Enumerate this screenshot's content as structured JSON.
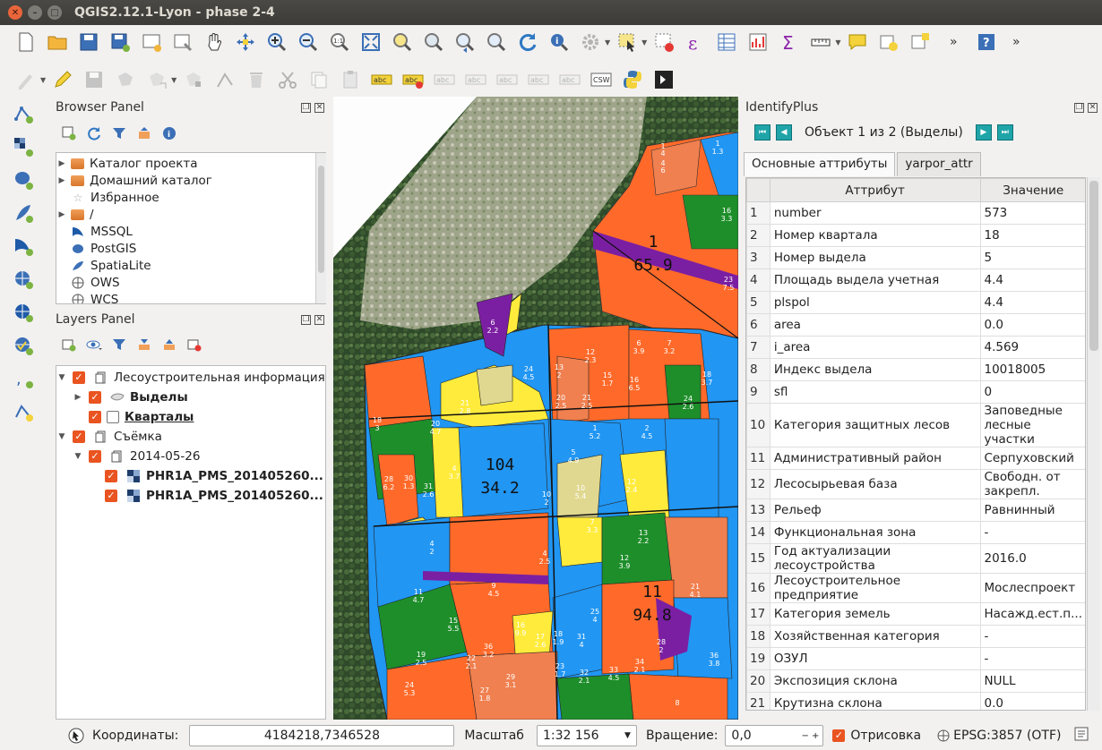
{
  "window": {
    "title": "QGIS2.12.1-Lyon - phase 2-4"
  },
  "browser_panel": {
    "title": "Browser Panel",
    "items": [
      {
        "label": "Каталог проекта",
        "icon": "folder-icon",
        "expandable": true
      },
      {
        "label": "Домашний каталог",
        "icon": "folder-icon",
        "expandable": true
      },
      {
        "label": "Избранное",
        "icon": "star-icon",
        "expandable": false
      },
      {
        "label": "/",
        "icon": "folder-icon",
        "expandable": true
      },
      {
        "label": "MSSQL",
        "icon": "mssql-icon",
        "expandable": false
      },
      {
        "label": "PostGIS",
        "icon": "postgis-icon",
        "expandable": false
      },
      {
        "label": "SpatiaLite",
        "icon": "spatialite-icon",
        "expandable": false
      },
      {
        "label": "OWS",
        "icon": "globe-icon",
        "expandable": false
      },
      {
        "label": "WCS",
        "icon": "globe-icon",
        "expandable": false
      }
    ]
  },
  "layers_panel": {
    "title": "Layers Panel",
    "group1": "Лесоустроительная информация",
    "layer_vydely": "Выделы",
    "layer_kvartaly": "Кварталы",
    "group2": "Съёмка",
    "subgroup": "2014-05-26",
    "raster1": "PHR1A_PMS_201405260...",
    "raster2": "PHR1A_PMS_201405260..."
  },
  "map": {
    "labels": [
      {
        "text": "1\n65.9"
      },
      {
        "text": "104\n34.2"
      },
      {
        "text": "11\n94.8"
      }
    ]
  },
  "identify_panel": {
    "title": "IdentifyPlus",
    "nav_text": "Объект 1 из 2 (Выделы)",
    "tabs": [
      "Основные аттрибуты",
      "yarpor_attr"
    ],
    "col_attr": "Аттрибут",
    "col_value": "Значение",
    "rows": [
      [
        "1",
        "number",
        "573"
      ],
      [
        "2",
        "Номер квартала",
        "18"
      ],
      [
        "3",
        "Номер выдела",
        "5"
      ],
      [
        "4",
        "Площадь выдела учетная",
        "4.4"
      ],
      [
        "5",
        "plspol",
        "4.4"
      ],
      [
        "6",
        "area",
        "0.0"
      ],
      [
        "7",
        "i_area",
        "4.569"
      ],
      [
        "8",
        "Индекс выдела",
        "10018005"
      ],
      [
        "9",
        "sfl",
        "0"
      ],
      [
        "10",
        "Категория защитных лесов",
        "Заповедные лесные участки"
      ],
      [
        "11",
        "Административный район",
        "Серпуховский"
      ],
      [
        "12",
        "Лесосырьевая база",
        "Свободн. от закрепл."
      ],
      [
        "13",
        "Рельеф",
        "Равнинный"
      ],
      [
        "14",
        "Функциональная зона",
        "-"
      ],
      [
        "15",
        "Год актуализации лесоустройства",
        "2016.0"
      ],
      [
        "16",
        "Лесоустроительное предприятие",
        "Мослеспроект"
      ],
      [
        "17",
        "Категория земель",
        "Насажд.ест.п..."
      ],
      [
        "18",
        "Хозяйственная категория",
        "-"
      ],
      [
        "19",
        "ОЗУЛ",
        "-"
      ],
      [
        "20",
        "Экспозиция склона",
        "NULL"
      ],
      [
        "21",
        "Крутизна склона",
        "0.0"
      ]
    ]
  },
  "status_bar": {
    "coords_label": "Координаты:",
    "coords_value": "4184218,7346528",
    "scale_label": "Масштаб",
    "scale_value": "1:32 156",
    "rotation_label": "Вращение:",
    "rotation_value": "0,0",
    "render_label": "Отрисовка",
    "crs": "EPSG:3857 (OTF)"
  }
}
